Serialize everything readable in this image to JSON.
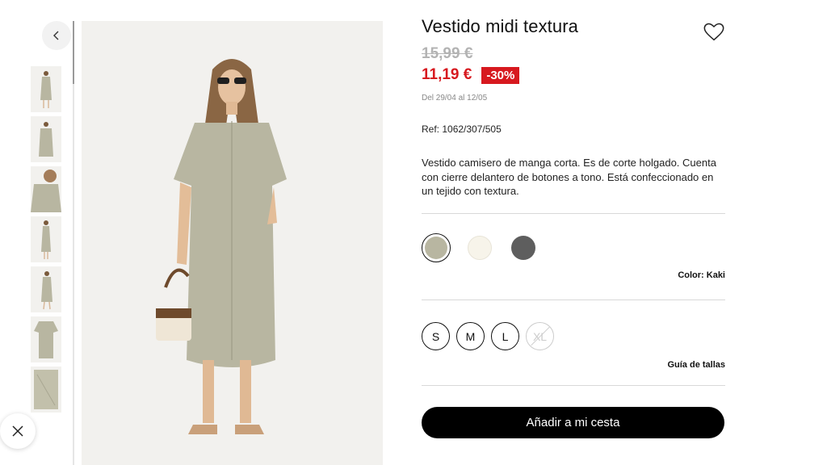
{
  "product": {
    "title": "Vestido midi textura",
    "old_price": "15,99 €",
    "price": "11,19 €",
    "discount": "-30%",
    "dates": "Del 29/04 al 12/05",
    "ref": "Ref: 1062/307/505",
    "description": "Vestido camisero de manga corta. Es de corte holgado. Cuenta con cierre delantero de botones a tono. Está confeccionado en un tejido con textura."
  },
  "colors": {
    "label": "Color: Kaki",
    "swatches": [
      "#b8b6a1",
      "#f7f4ea",
      "#5e5e5e"
    ],
    "selected": 0
  },
  "sizes": {
    "options": [
      "S",
      "M",
      "L",
      "XL"
    ],
    "guide_label": "Guía de tallas"
  },
  "cta": {
    "add_to_cart": "Añadir a mi cesta"
  },
  "gallery": {
    "thumb_count": 7
  },
  "palette": {
    "accent_red": "#d7191f",
    "dress_khaki": "#b8b6a1"
  }
}
